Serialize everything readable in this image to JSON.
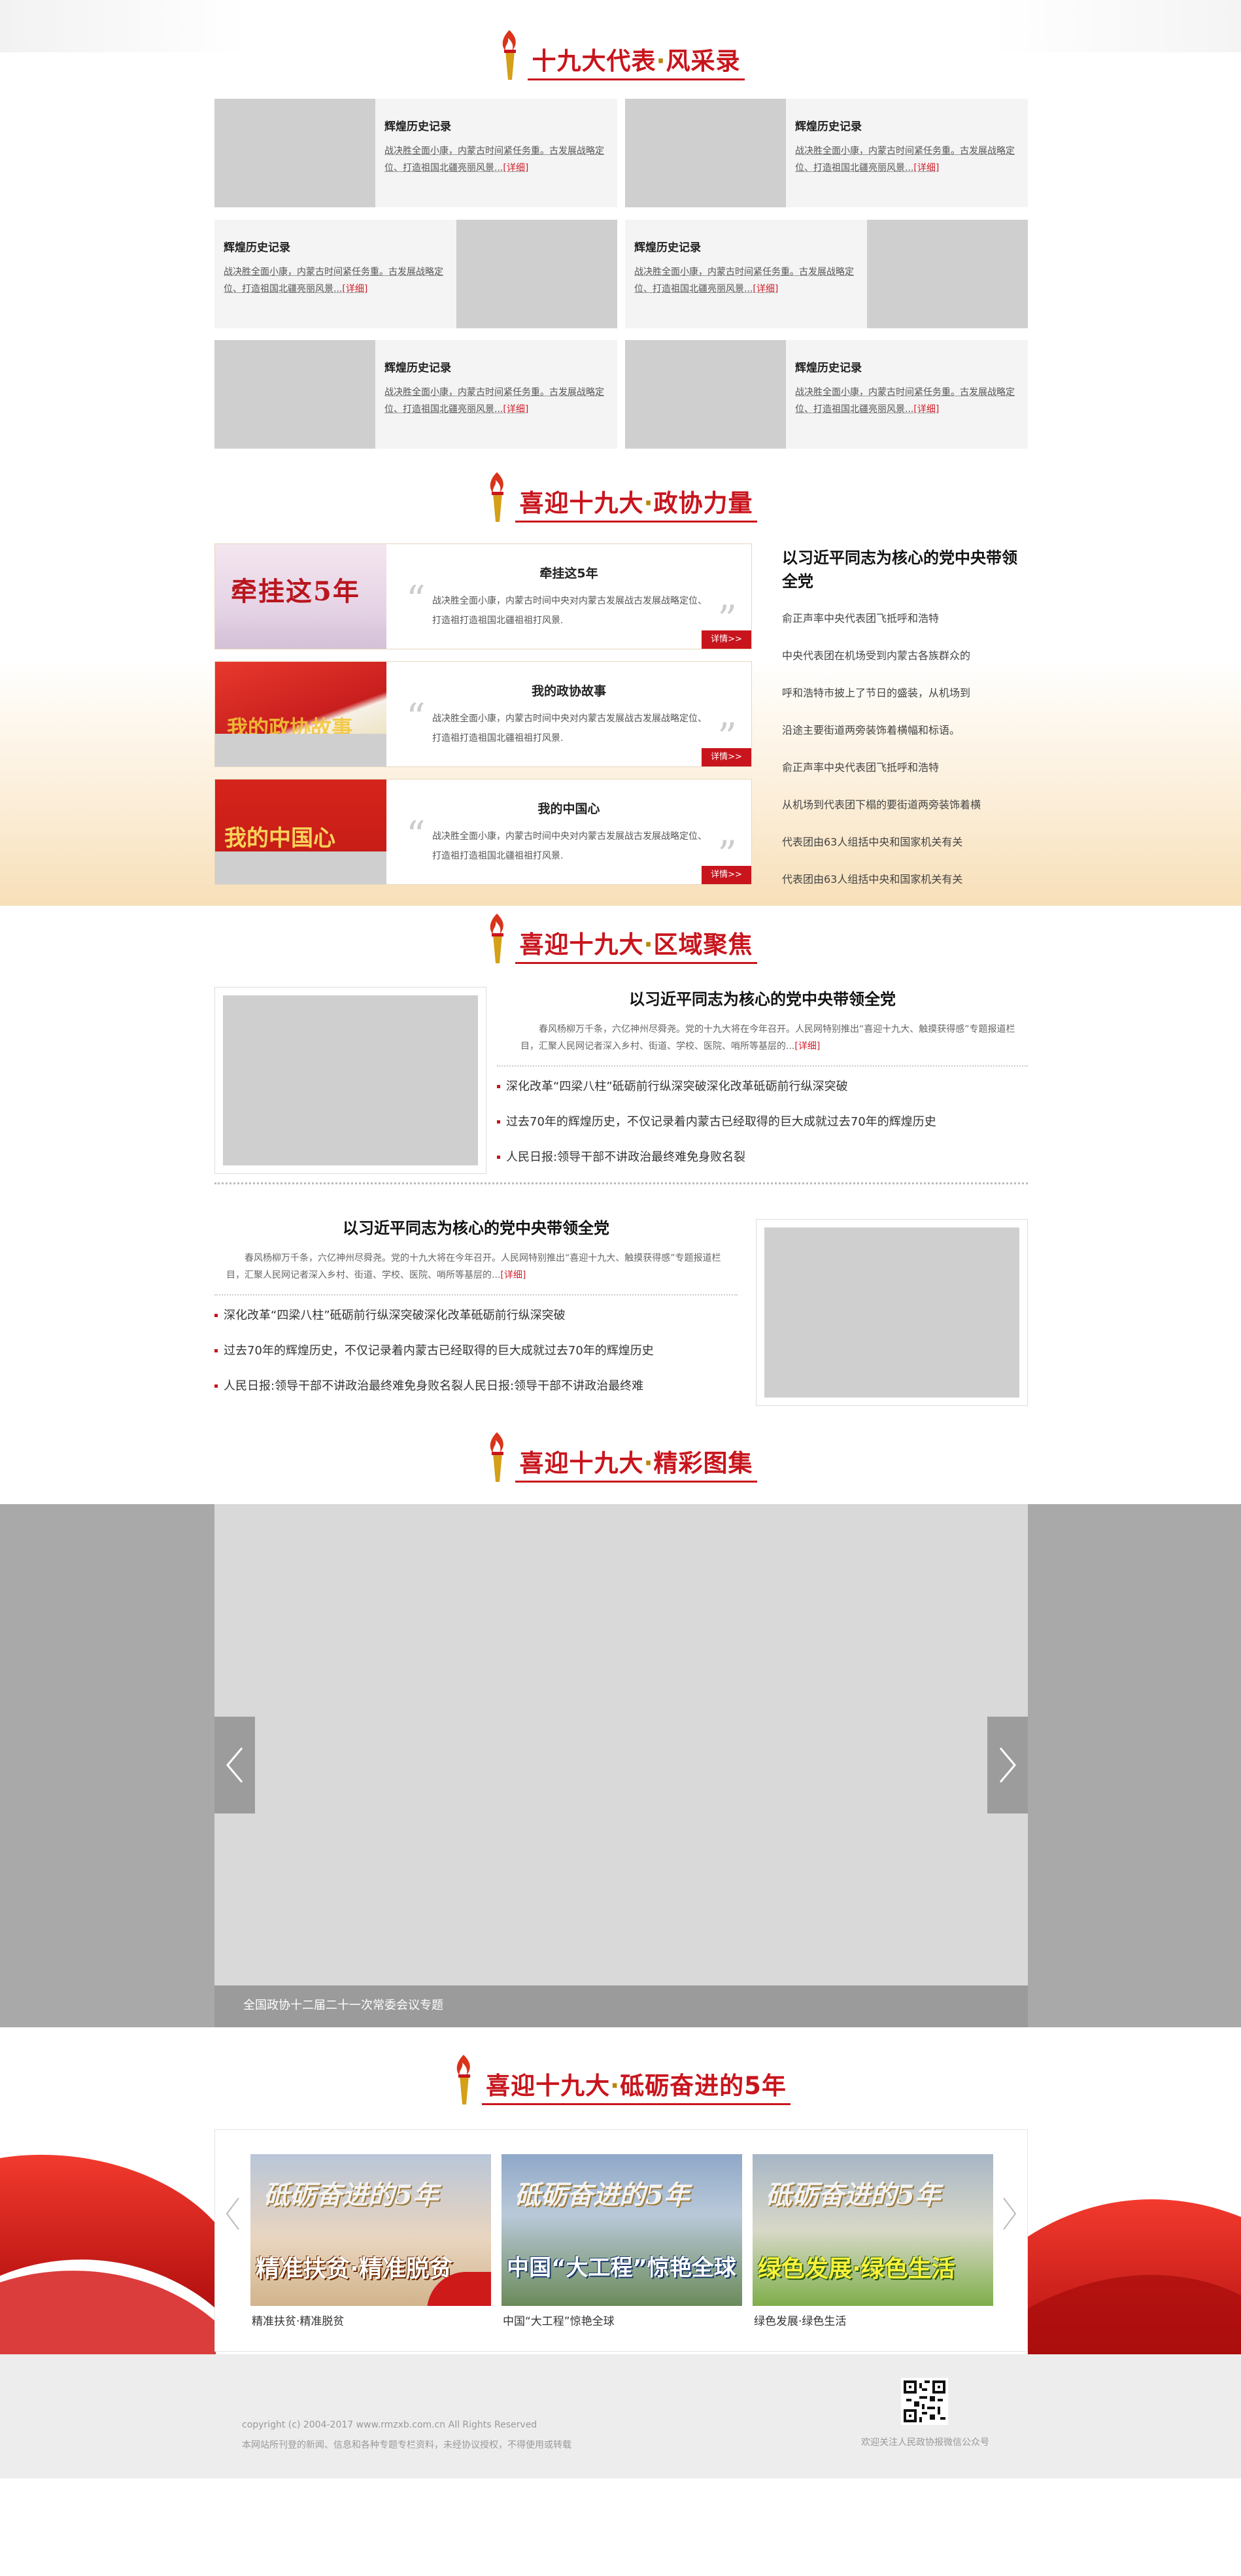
{
  "sections": {
    "representatives": {
      "title_a": "十九大代表",
      "title_dot": "·",
      "title_b": "风采录"
    },
    "cppcc": {
      "title_a": "喜迎十九大",
      "title_dot": "·",
      "title_b": "政协力量"
    },
    "region": {
      "title_a": "喜迎十九大",
      "title_dot": "·",
      "title_b": "区域聚焦"
    },
    "gallery": {
      "title_a": "喜迎十九大",
      "title_dot": "·",
      "title_b": "精彩图集"
    },
    "fiveyears": {
      "title_a": "喜迎十九大",
      "title_dot": "·",
      "title_b": "砥砺奋进的5年"
    }
  },
  "rep_cards": [
    {
      "title": "辉煌历史记录",
      "desc": "战决胜全面小康，内蒙古时间紧任务重。古发展战略定位、打造祖国北疆亮丽风景...",
      "more": "[详细]"
    },
    {
      "title": "辉煌历史记录",
      "desc": "战决胜全面小康，内蒙古时间紧任务重。古发展战略定位、打造祖国北疆亮丽风景...",
      "more": "[详细]"
    },
    {
      "title": "辉煌历史记录",
      "desc": "战决胜全面小康，内蒙古时间紧任务重。古发展战略定位、打造祖国北疆亮丽风景...",
      "more": "[详细]"
    },
    {
      "title": "辉煌历史记录",
      "desc": "战决胜全面小康，内蒙古时间紧任务重。古发展战略定位、打造祖国北疆亮丽风景...",
      "more": "[详细]"
    },
    {
      "title": "辉煌历史记录",
      "desc": "战决胜全面小康，内蒙古时间紧任务重。古发展战略定位、打造祖国北疆亮丽风景...",
      "more": "[详细]"
    },
    {
      "title": "辉煌历史记录",
      "desc": "战决胜全面小康，内蒙古时间紧任务重。古发展战略定位、打造祖国北疆亮丽风景...",
      "more": "[详细]"
    }
  ],
  "cppcc_items": [
    {
      "banner": "牵挂这5年",
      "title": "牵挂这5年",
      "desc": "战决胜全面小康，内蒙古时间中央对内蒙古发展战古发展战略定位、打造祖打造祖国北疆祖祖打风景.",
      "more": "详情>>"
    },
    {
      "banner": "我的政协故事",
      "title": "我的政协故事",
      "desc": "战决胜全面小康，内蒙古时间中央对内蒙古发展战古发展战略定位、打造祖打造祖国北疆祖祖打风景.",
      "more": "详情>>"
    },
    {
      "banner": "我的中国心",
      "title": "我的中国心",
      "desc": "战决胜全面小康，内蒙古时间中央对内蒙古发展战古发展战略定位、打造祖打造祖国北疆祖祖打风景.",
      "more": "详情>>"
    }
  ],
  "cppcc_right": {
    "headline": "以习近平同志为核心的党中央带领全党",
    "lines": [
      "俞正声率中央代表团飞抵呼和浩特",
      "中央代表团在机场受到内蒙古各族群众的",
      "呼和浩特市披上了节日的盛装，从机场到",
      "沿途主要街道两旁装饰着横幅和标语。",
      "俞正声率中央代表团飞抵呼和浩特",
      "从机场到代表团下榻的要街道两旁装饰着横",
      "代表团由63人组括中央和国家机关有关",
      "代表团由63人组括中央和国家机关有关"
    ]
  },
  "region_blocks": [
    {
      "title": "以习近平同志为核心的党中央带领全党",
      "desc": "春风杨柳万千条，六亿神州尽舜尧。党的十九大将在今年召开。人民网特别推出“喜迎十九大、触摸获得感”专题报道栏目，汇聚人民网记者深入乡村、街道、学校、医院、哨所等基层的...",
      "more": "[详细]",
      "news": [
        "深化改革“四梁八柱”砥砺前行纵深突破深化改革砥砺前行纵深突破",
        "过去70年的辉煌历史，不仅记录着内蒙古已经取得的巨大成就过去70年的辉煌历史",
        "人民日报:领导干部不讲政治最终难免身败名裂"
      ]
    },
    {
      "title": "以习近平同志为核心的党中央带领全党",
      "desc": "春风杨柳万千条，六亿神州尽舜尧。党的十九大将在今年召开。人民网特别推出“喜迎十九大、触摸获得感”专题报道栏目，汇聚人民网记者深入乡村、街道、学校、医院、哨所等基层的...",
      "more": "[详细]",
      "news": [
        "深化改革“四梁八柱”砥砺前行纵深突破深化改革砥砺前行纵深突破",
        "过去70年的辉煌历史，不仅记录着内蒙古已经取得的巨大成就过去70年的辉煌历史",
        "人民日报:领导干部不讲政治最终难免身败名裂人民日报:领导干部不讲政治最终难"
      ]
    }
  ],
  "gallery": {
    "caption": "全国政协十二届二十一次常委会议专题"
  },
  "fiveyears": {
    "thumbs": [
      {
        "art": "砥砺奋进的5年",
        "headline": "精准扶贫·精准脱贫",
        "caption": "精准扶贫·精准脱贫"
      },
      {
        "art": "砥砺奋进的5年",
        "headline": "中国“大工程”惊艳全球",
        "caption": "中国“大工程”惊艳全球"
      },
      {
        "art": "砥砺奋进的5年",
        "headline": "绿色发展·绿色生活",
        "caption": "绿色发展·绿色生活"
      }
    ]
  },
  "footer": {
    "copyright": "copyright (c) 2004-2017 www.rmzxb.com.cn All Rights Reserved",
    "note": "本网站所刊登的新闻、信息和各种专题专栏资料，未经协议授权，不得使用或转载",
    "qr_caption": "欢迎关注人民政协报微信公众号"
  },
  "colors": {
    "red": "#c8151d",
    "gold": "#b8860b",
    "gray_bg": "#a9a9a9",
    "placeholder": "#cfcfcf"
  }
}
